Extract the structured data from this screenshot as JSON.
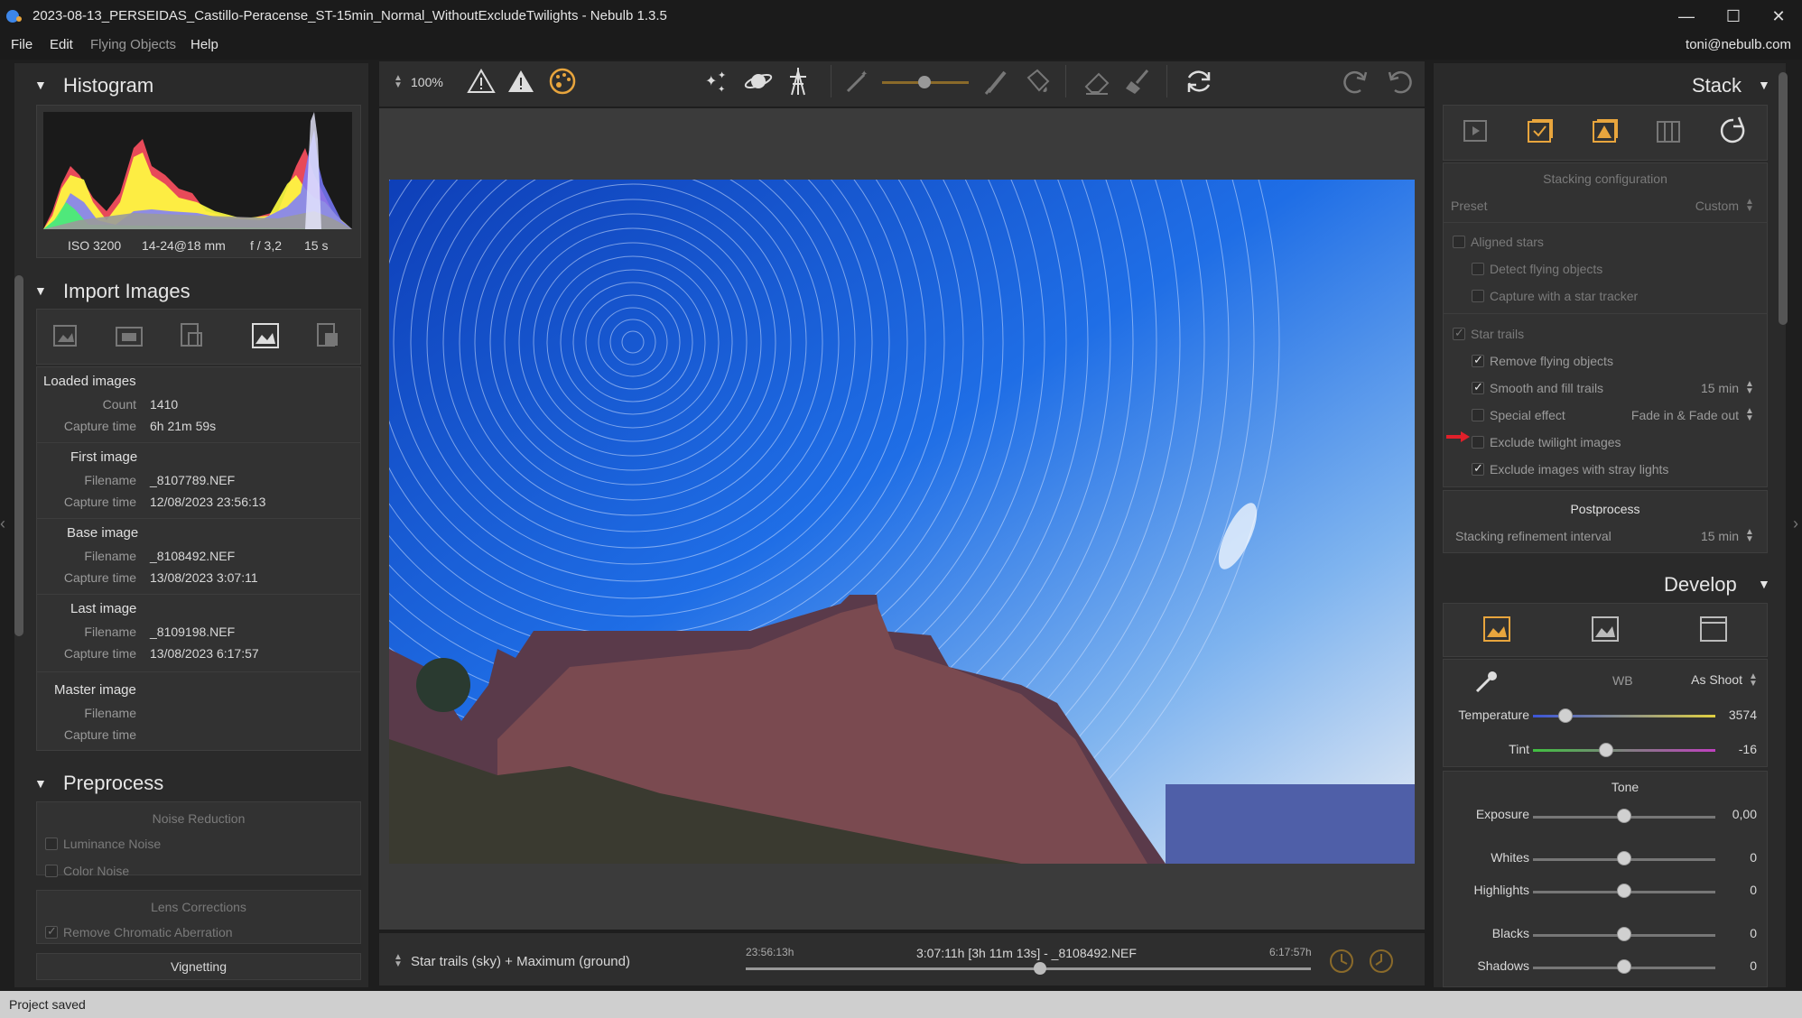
{
  "window": {
    "title": "2023-08-13_PERSEIDAS_Castillo-Peracense_ST-15min_Normal_WithoutExcludeTwilights - Nebulb 1.3.5",
    "minimize": "—",
    "maximize": "☐",
    "close": "✕"
  },
  "menu": {
    "file": "File",
    "edit": "Edit",
    "flying_objects": "Flying Objects",
    "help": "Help",
    "user": "toni@nebulb.com"
  },
  "histogram": {
    "title": "Histogram",
    "iso": "ISO 3200",
    "lens": "14-24@18 mm",
    "aperture": "f / 3,2",
    "shutter": "15 s"
  },
  "import_images": {
    "title": "Import Images",
    "loaded": {
      "heading": "Loaded images",
      "count_label": "Count",
      "count": "1410",
      "capture_label": "Capture time",
      "capture": "6h 21m 59s"
    },
    "first": {
      "heading": "First image",
      "filename_label": "Filename",
      "filename": "_8107789.NEF",
      "capture_label": "Capture time",
      "capture": "12/08/2023 23:56:13"
    },
    "base": {
      "heading": "Base image",
      "filename_label": "Filename",
      "filename": "_8108492.NEF",
      "capture_label": "Capture time",
      "capture": "13/08/2023 3:07:11"
    },
    "last": {
      "heading": "Last image",
      "filename_label": "Filename",
      "filename": "_8109198.NEF",
      "capture_label": "Capture time",
      "capture": "13/08/2023 6:17:57"
    },
    "master": {
      "heading": "Master image",
      "filename_label": "Filename",
      "capture_label": "Capture time"
    }
  },
  "preprocess": {
    "title": "Preprocess",
    "noise_heading": "Noise Reduction",
    "luminance": "Luminance Noise",
    "color": "Color Noise",
    "lens_heading": "Lens Corrections",
    "chromatic": "Remove Chromatic Aberration",
    "vignetting": "Vignetting"
  },
  "toolbar": {
    "zoom": "100%"
  },
  "timeline": {
    "mode": "Star trails (sky) + Maximum (ground)",
    "start": "23:56:13h",
    "current": "3:07:11h [3h 11m 13s] - _8108492.NEF",
    "end": "6:17:57h",
    "position": 0.52
  },
  "stack": {
    "title": "Stack",
    "config_heading": "Stacking configuration",
    "preset_label": "Preset",
    "preset_value": "Custom",
    "aligned_stars": "Aligned stars",
    "detect_flying": "Detect flying objects",
    "star_tracker": "Capture with a star tracker",
    "star_trails": "Star trails",
    "remove_flying": "Remove flying objects",
    "smooth_fill": "Smooth and fill trails",
    "smooth_value": "15 min",
    "special_effect": "Special effect",
    "special_value": "Fade in & Fade out",
    "exclude_twilight": "Exclude twilight images",
    "exclude_stray": "Exclude images with stray lights",
    "post_heading": "Postprocess",
    "refinement_label": "Stacking refinement interval",
    "refinement_value": "15 min"
  },
  "develop": {
    "title": "Develop",
    "wb_label": "WB",
    "wb_value": "As Shoot",
    "temperature_label": "Temperature",
    "temperature": "3574",
    "tint_label": "Tint",
    "tint": "-16",
    "tone_heading": "Tone",
    "exposure_label": "Exposure",
    "exposure": "0,00",
    "whites_label": "Whites",
    "whites": "0",
    "highlights_label": "Highlights",
    "highlights": "0",
    "blacks_label": "Blacks",
    "blacks": "0",
    "shadows_label": "Shadows",
    "shadows": "0"
  },
  "status": {
    "text": "Project saved"
  },
  "colors": {
    "accent": "#e8a53d",
    "sky": "#1f5fd6",
    "status_bg": "#cfcfcf"
  }
}
